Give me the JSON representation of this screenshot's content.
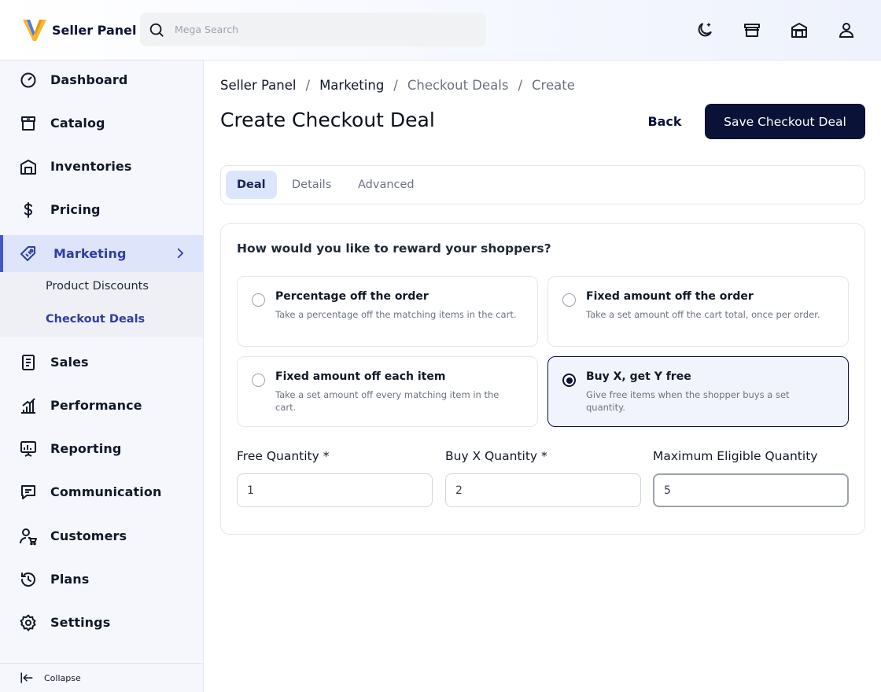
{
  "app": {
    "name": "Seller Panel"
  },
  "search": {
    "placeholder": "Mega Search",
    "value": ""
  },
  "header_icons": [
    "moon-icon",
    "store-icon",
    "warehouse-icon",
    "user-icon"
  ],
  "sidebar": {
    "items": [
      {
        "label": "Dashboard",
        "icon": "gauge-icon"
      },
      {
        "label": "Catalog",
        "icon": "catalog-icon"
      },
      {
        "label": "Inventories",
        "icon": "warehouse-icon"
      },
      {
        "label": "Pricing",
        "icon": "dollar-icon"
      },
      {
        "label": "Marketing",
        "icon": "tag-icon",
        "active": true
      },
      {
        "label": "Sales",
        "icon": "receipt-icon"
      },
      {
        "label": "Performance",
        "icon": "bar-chart-icon"
      },
      {
        "label": "Reporting",
        "icon": "presentation-icon"
      },
      {
        "label": "Communication",
        "icon": "message-icon"
      },
      {
        "label": "Customers",
        "icon": "customers-icon"
      },
      {
        "label": "Plans",
        "icon": "history-icon"
      },
      {
        "label": "Settings",
        "icon": "gear-icon"
      }
    ],
    "marketing_sub": [
      {
        "label": "Product Discounts"
      },
      {
        "label": "Checkout Deals",
        "active": true
      }
    ],
    "collapse_label": "Collapse"
  },
  "breadcrumb": [
    "Seller Panel",
    "Marketing",
    "Checkout Deals",
    "Create"
  ],
  "page": {
    "title": "Create Checkout Deal",
    "back_label": "Back",
    "save_label": "Save Checkout Deal"
  },
  "tabs": [
    {
      "label": "Deal",
      "active": true
    },
    {
      "label": "Details"
    },
    {
      "label": "Advanced"
    }
  ],
  "deal": {
    "question": "How would you like to reward your shoppers?",
    "options": [
      {
        "title": "Percentage off the order",
        "desc": "Take a percentage off the matching items in the cart.",
        "selected": false
      },
      {
        "title": "Fixed amount off the order",
        "desc": "Take a set amount off the cart total, once per order.",
        "selected": false
      },
      {
        "title": "Fixed amount off each item",
        "desc": "Take a set amount off every matching item in the cart.",
        "selected": false
      },
      {
        "title": "Buy X, get Y free",
        "desc": "Give free items when the shopper buys a set quantity.",
        "selected": true
      }
    ],
    "fields": [
      {
        "label": "Free Quantity *",
        "value": "1"
      },
      {
        "label": "Buy X Quantity *",
        "value": "2"
      },
      {
        "label": "Maximum Eligible Quantity",
        "value": "5"
      }
    ]
  },
  "colors": {
    "primary": "#0b1238",
    "accent": "#4357c9",
    "logo_yellow": "#f5b82e",
    "logo_blue": "#4d7ce8"
  }
}
